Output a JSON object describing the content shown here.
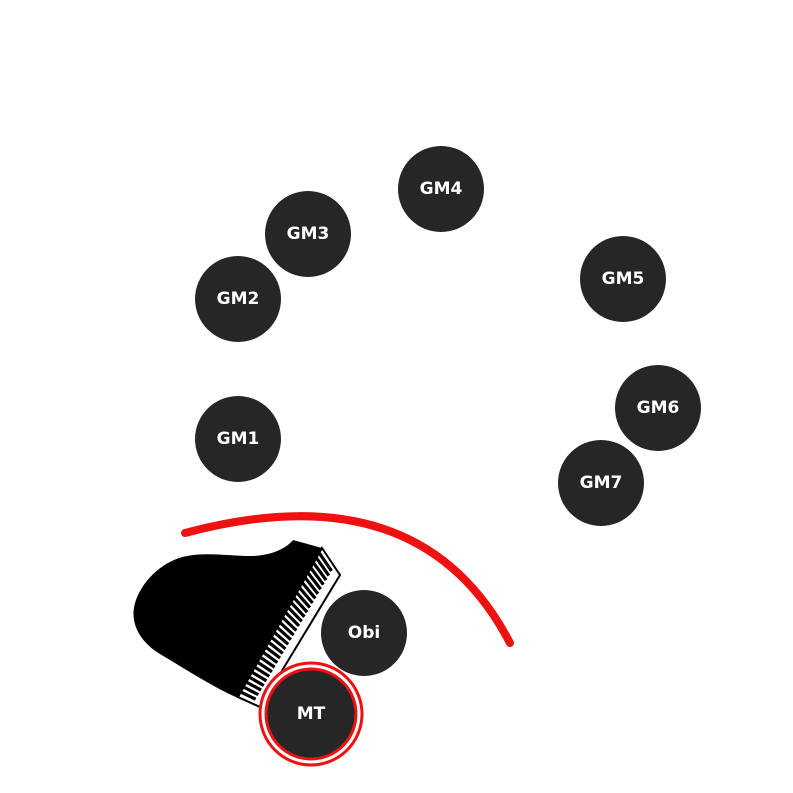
{
  "colors": {
    "background": "#ffffff",
    "node_fill": "#262626",
    "node_text": "#ffffff",
    "arc": "#ee1111",
    "piano": "#000000"
  },
  "icons": {
    "piano": "grand-piano-icon"
  },
  "nodes": [
    {
      "id": "gm1",
      "label": "GM1"
    },
    {
      "id": "gm2",
      "label": "GM2"
    },
    {
      "id": "gm3",
      "label": "GM3"
    },
    {
      "id": "gm4",
      "label": "GM4"
    },
    {
      "id": "gm5",
      "label": "GM5"
    },
    {
      "id": "gm6",
      "label": "GM6"
    },
    {
      "id": "gm7",
      "label": "GM7"
    },
    {
      "id": "obi",
      "label": "Obi"
    },
    {
      "id": "mt",
      "label": "MT",
      "highlighted": true
    }
  ]
}
